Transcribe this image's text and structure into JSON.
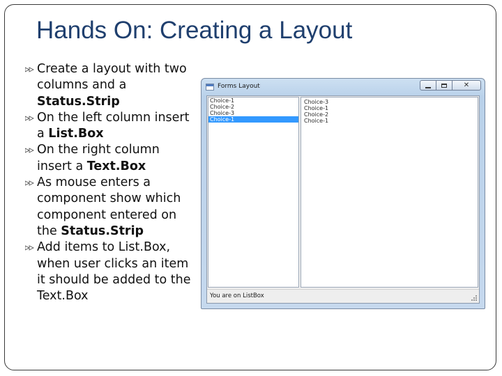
{
  "slide": {
    "title": "Hands On: Creating a Layout",
    "bullets": [
      {
        "before": "Create a layout with two columns and a ",
        "em": "Status.Strip",
        "after": ""
      },
      {
        "before": "On the left column insert a ",
        "em": "List.Box",
        "after": ""
      },
      {
        "before": "On the right column insert a ",
        "em": "Text.Box",
        "after": ""
      },
      {
        "before": "As mouse enters a component show which component entered on the ",
        "em": "Status.Strip",
        "after": ""
      },
      {
        "before": "Add items to List.Box, when user clicks an item it should be added to the Text.Box",
        "em": "",
        "after": ""
      }
    ],
    "bullet_icon": "arrow-bullet-icon",
    "title_color": "#1f3f6e"
  },
  "window": {
    "title": "Forms Layout",
    "icons": [
      "minimize-icon",
      "maximize-icon",
      "close-icon"
    ],
    "listbox": {
      "items": [
        "Choice-1",
        "Choice-2",
        "Choice-3",
        "Choice-1"
      ],
      "selected_index": 3,
      "selection_color": "#3399ff"
    },
    "textbox": {
      "lines": [
        "Choice-3",
        "Choice-1",
        "Choice-2",
        "Choice-1"
      ]
    },
    "status_text": "You are on ListBox"
  }
}
